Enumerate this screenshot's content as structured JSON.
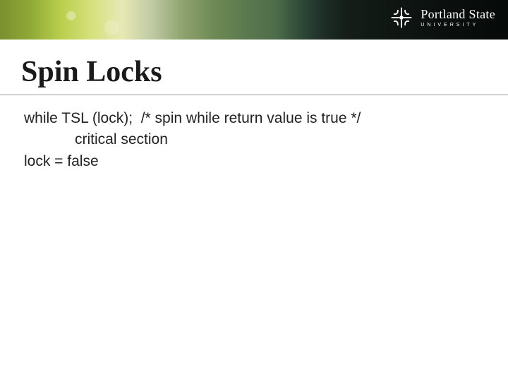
{
  "brand": {
    "name": "Portland State",
    "subline": "UNIVERSITY"
  },
  "slide": {
    "title": "Spin Locks",
    "code": {
      "line1": "while TSL (lock);  /* spin while return value is true */",
      "line2": "critical section",
      "line3": "lock = false"
    }
  }
}
